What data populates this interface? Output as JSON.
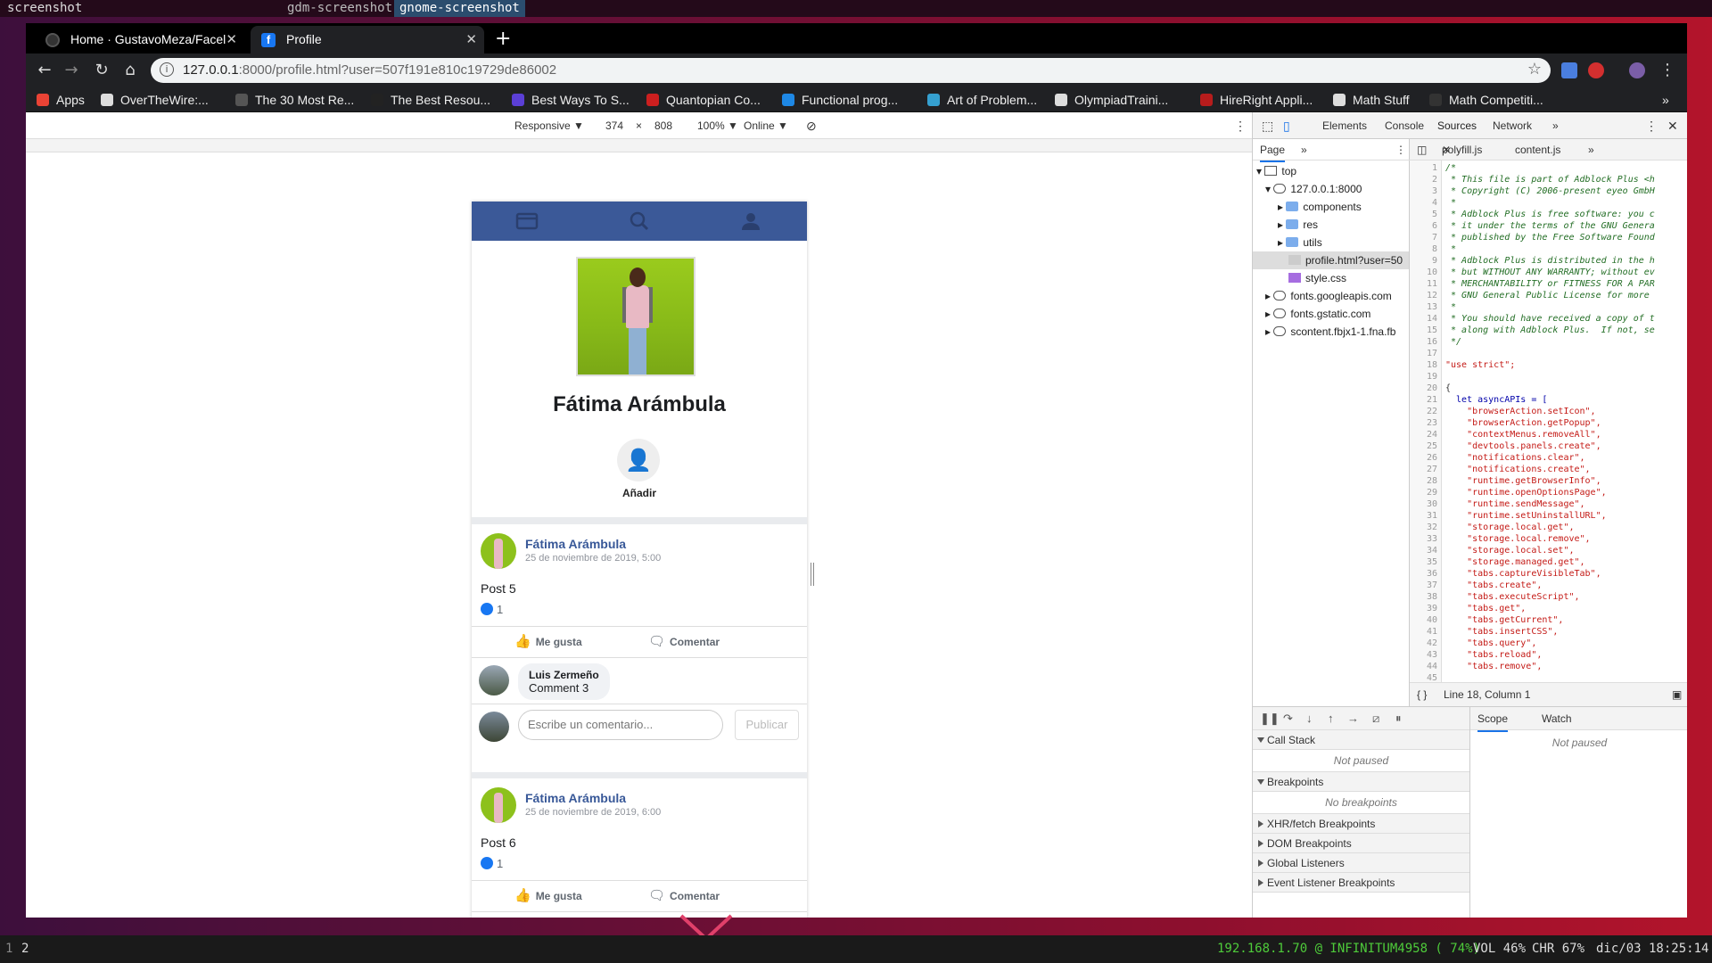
{
  "wm": {
    "prompt": "screenshot",
    "options": [
      "gdm-screenshot",
      "gnome-screenshot"
    ]
  },
  "browser": {
    "tabs": [
      {
        "title": "Home · GustavoMeza/Facel",
        "icon": "github-icon"
      },
      {
        "title": "Profile",
        "icon": "facebook-icon"
      }
    ],
    "new_tab": "+",
    "url_host": "127.0.0.1",
    "url_rest": ":8000/profile.html?user=507f191e810c19729de86002",
    "bookmarks": [
      {
        "label": "Apps",
        "color": "#ea4335"
      },
      {
        "label": "OverTheWire:...",
        "color": "#dddddd"
      },
      {
        "label": "The 30 Most Re...",
        "color": "#555555"
      },
      {
        "label": "The Best Resou...",
        "color": "#222222"
      },
      {
        "label": "Best Ways To S...",
        "color": "#5b3fd6"
      },
      {
        "label": "Quantopian Co...",
        "color": "#cc1f1f"
      },
      {
        "label": "Functional prog...",
        "color": "#1e88e5"
      },
      {
        "label": "Art of Problem...",
        "color": "#35a0d0"
      },
      {
        "label": "OlympiadTraini...",
        "color": "#dddddd"
      },
      {
        "label": "HireRight Appli...",
        "color": "#b71c1c"
      },
      {
        "label": "Math Stuff",
        "color": "#dddddd"
      },
      {
        "label": "Math Competiti...",
        "color": "#333333"
      }
    ]
  },
  "devbar": {
    "device": "Responsive ▼",
    "width": "374",
    "times": "×",
    "height": "808",
    "zoom": "100% ▼",
    "network": "Online ▼"
  },
  "page": {
    "profile_name": "Fátima Arámbula",
    "add_label": "Añadir",
    "posts": [
      {
        "author": "Fátima Arámbula",
        "date": "25 de noviembre de 2019, 5:00",
        "text": "Post 5",
        "likes": "1",
        "like_label": "Me gusta",
        "comment_label": "Comentar",
        "comments": [
          {
            "user": "Luis Zermeño",
            "text": "Comment 3"
          }
        ],
        "input_placeholder": "Escribe un comentario...",
        "publish_label": "Publicar"
      },
      {
        "author": "Fátima Arámbula",
        "date": "25 de noviembre de 2019, 6:00",
        "text": "Post 6",
        "likes": "1",
        "like_label": "Me gusta",
        "comment_label": "Comentar"
      }
    ]
  },
  "devtools": {
    "tabs": [
      "Elements",
      "Console",
      "Sources",
      "Network",
      "»"
    ],
    "active_tab": "Sources",
    "navigator": {
      "header": "Page",
      "items": [
        "top",
        "127.0.0.1:8000",
        "components",
        "res",
        "utils",
        "profile.html?user=50",
        "style.css",
        "fonts.googleapis.com",
        "fonts.gstatic.com",
        "scontent.fbjx1-1.fna.fb"
      ]
    },
    "editor_tabs": [
      "polyfill.js",
      "content.js"
    ],
    "code_lines": [
      "/*",
      " * This file is part of Adblock Plus <h",
      " * Copyright (C) 2006-present eyeo GmbH",
      " *",
      " * Adblock Plus is free software: you c",
      " * it under the terms of the GNU Genera",
      " * published by the Free Software Found",
      " *",
      " * Adblock Plus is distributed in the h",
      " * but WITHOUT ANY WARRANTY; without ev",
      " * MERCHANTABILITY or FITNESS FOR A PAR",
      " * GNU General Public License for more",
      " *",
      " * You should have received a copy of t",
      " * along with Adblock Plus.  If not, se",
      " */",
      "",
      "\"use strict\";",
      "",
      "{",
      "  let asyncAPIs = [",
      "    \"browserAction.setIcon\",",
      "    \"browserAction.getPopup\",",
      "    \"contextMenus.removeAll\",",
      "    \"devtools.panels.create\",",
      "    \"notifications.clear\",",
      "    \"notifications.create\",",
      "    \"runtime.getBrowserInfo\",",
      "    \"runtime.openOptionsPage\",",
      "    \"runtime.sendMessage\",",
      "    \"runtime.setUninstallURL\",",
      "    \"storage.local.get\",",
      "    \"storage.local.remove\",",
      "    \"storage.local.set\",",
      "    \"storage.managed.get\",",
      "    \"tabs.captureVisibleTab\",",
      "    \"tabs.create\",",
      "    \"tabs.executeScript\",",
      "    \"tabs.get\",",
      "    \"tabs.getCurrent\",",
      "    \"tabs.insertCSS\",",
      "    \"tabs.query\",",
      "    \"tabs.reload\",",
      "    \"tabs.remove\",",
      ""
    ],
    "status": "Line 18, Column 1",
    "debugger": {
      "call_stack": "Call Stack",
      "not_paused": "Not paused",
      "breakpoints": "Breakpoints",
      "no_breakpoints": "No breakpoints",
      "xhr": "XHR/fetch Breakpoints",
      "dom": "DOM Breakpoints",
      "global": "Global Listeners",
      "event": "Event Listener Breakpoints",
      "scope_tab": "Scope",
      "watch_tab": "Watch",
      "scope_note": "Not paused"
    }
  },
  "panel": {
    "ws1": "1",
    "ws2": "2",
    "net": "192.168.1.70 @ INFINITUM4958 ( 74%)",
    "vol": "VOL 46%",
    "chr": "CHR 67%",
    "clock": "dic/03 18:25:14"
  }
}
